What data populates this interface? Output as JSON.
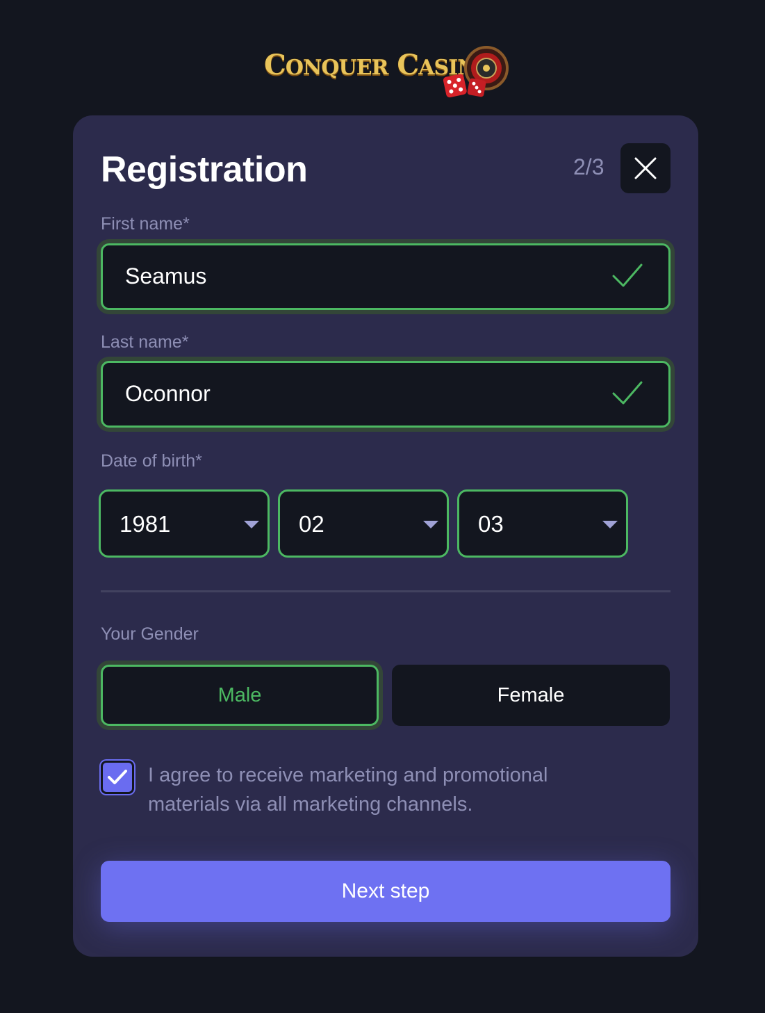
{
  "brand": {
    "logo_text": "Conquer Casino"
  },
  "header": {
    "title": "Registration",
    "step": "2/3"
  },
  "form": {
    "first_name": {
      "label": "First name*",
      "value": "Seamus"
    },
    "last_name": {
      "label": "Last name*",
      "value": "Oconnor"
    },
    "dob": {
      "label": "Date of birth*",
      "year": "1981",
      "month": "02",
      "day": "03"
    },
    "gender": {
      "label": "Your Gender",
      "options": [
        "Male",
        "Female"
      ],
      "selected": "Male"
    },
    "consent": {
      "checked": true,
      "text": "I agree to receive marketing and promotional materials via all marketing channels."
    },
    "submit_label": "Next step"
  },
  "colors": {
    "background": "#13161f",
    "card": "#2c2b4c",
    "valid": "#4cb862",
    "accent": "#6e71f2",
    "muted_text": "#8e8fb5"
  },
  "icons": [
    "close-icon",
    "check-icon",
    "chevron-down-icon",
    "checkbox-check-icon"
  ]
}
